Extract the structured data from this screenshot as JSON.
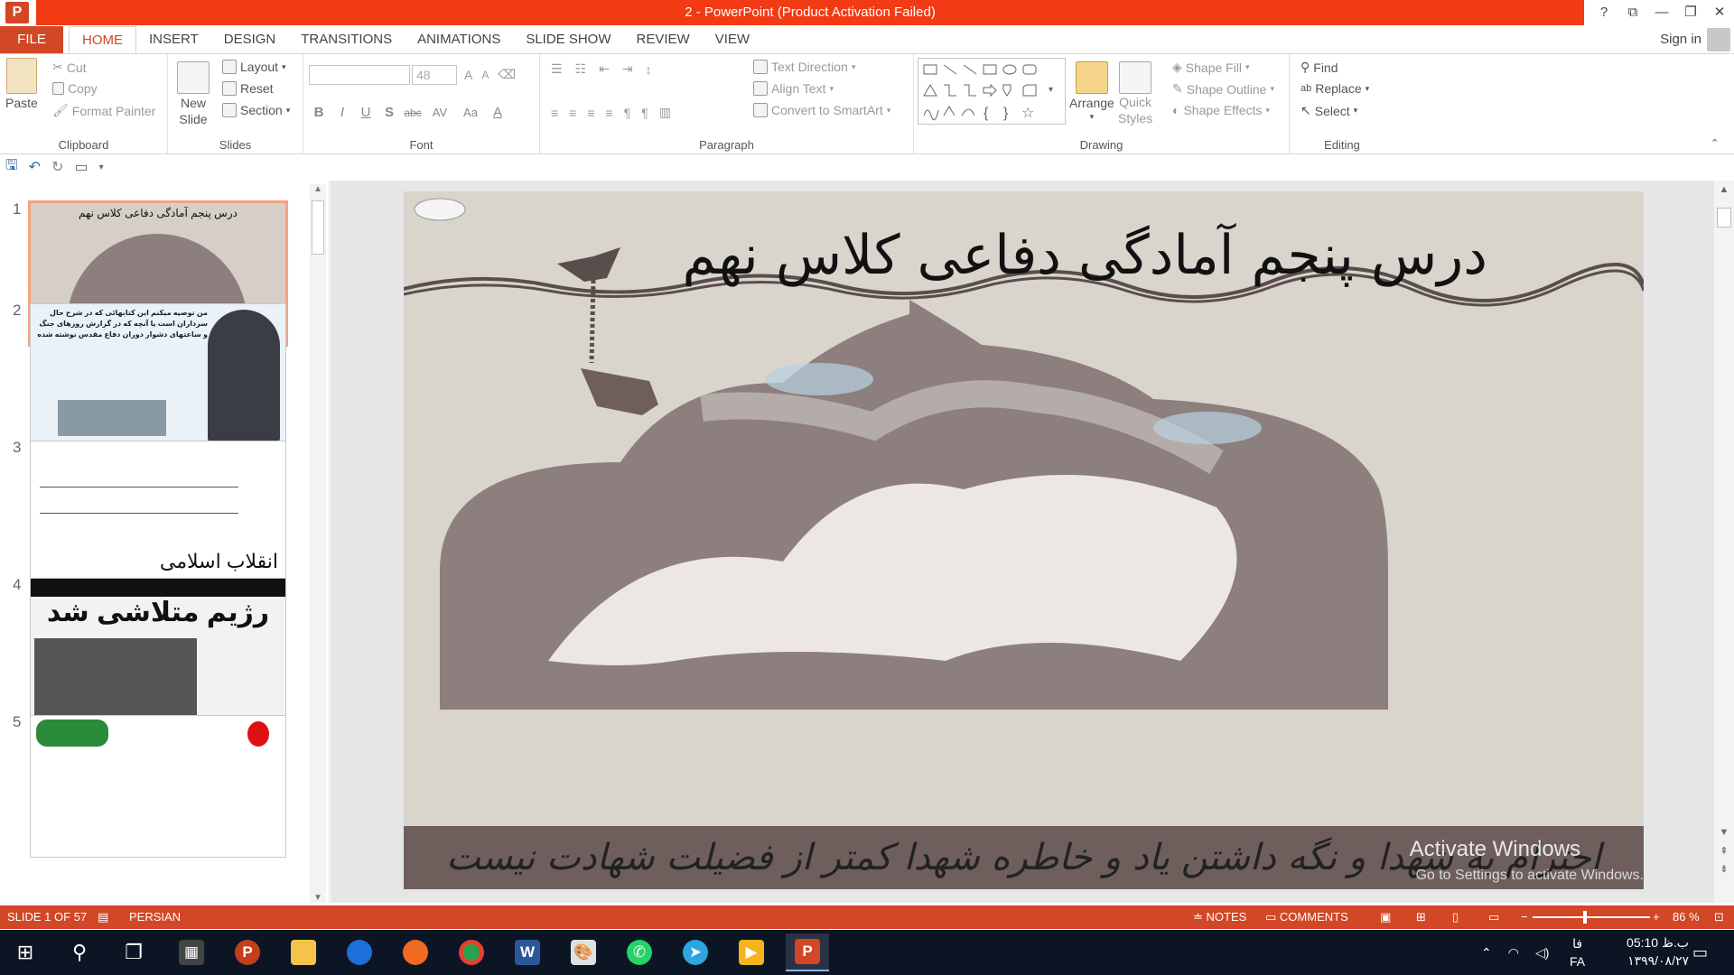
{
  "window": {
    "title": "2 -  PowerPoint (Product Activation Failed)",
    "app_icon": "P",
    "buttons": {
      "help": "?",
      "ribbon_options": "⧉",
      "minimize": "—",
      "restore": "❐",
      "close": "✕"
    }
  },
  "tabs": {
    "file": "FILE",
    "items": [
      "HOME",
      "INSERT",
      "DESIGN",
      "TRANSITIONS",
      "ANIMATIONS",
      "SLIDE SHOW",
      "REVIEW",
      "VIEW"
    ],
    "active": "HOME",
    "sign_in": "Sign in"
  },
  "ribbon": {
    "clipboard": {
      "label": "Clipboard",
      "paste": "Paste",
      "cut": "Cut",
      "copy": "Copy",
      "format_painter": "Format Painter"
    },
    "slides": {
      "label": "Slides",
      "new_slide_1": "New",
      "new_slide_2": "Slide",
      "layout": "Layout",
      "reset": "Reset",
      "section": "Section"
    },
    "font": {
      "label": "Font",
      "font_name": "",
      "font_size": "48",
      "bold": "B",
      "italic": "I",
      "underline": "U",
      "shadow": "S",
      "strike": "abc",
      "spacing": "AV",
      "case": "Aa",
      "color": "A",
      "grow": "A",
      "shrink": "A"
    },
    "paragraph": {
      "label": "Paragraph",
      "text_direction": "Text Direction",
      "align_text": "Align Text",
      "smartart": "Convert to SmartArt"
    },
    "drawing": {
      "label": "Drawing",
      "arrange": "Arrange",
      "quick_styles_1": "Quick",
      "quick_styles_2": "Styles",
      "shape_fill": "Shape Fill",
      "shape_outline": "Shape Outline",
      "shape_effects": "Shape Effects"
    },
    "editing": {
      "label": "Editing",
      "find": "Find",
      "replace": "Replace",
      "select": "Select"
    }
  },
  "thumbnails": [
    {
      "num": "1",
      "text": "درس پنجم آمادگی دفاعی کلاس نهم"
    },
    {
      "num": "2",
      "text": "من توصیه میکنم این کتابهائی که در شرح حال سرداران است یا آنچه که در گزارش روزهای جنگ و ساعتهای دشوار دوران دفاع مقدس نوشته شده"
    },
    {
      "num": "3",
      "text": "انقلاب اسلامی"
    },
    {
      "num": "4",
      "text": "رژیم متلاشی شد"
    },
    {
      "num": "5",
      "text": ""
    }
  ],
  "slide": {
    "title": "درس پنجم آمادگی دفاعی کلاس نهم",
    "caption": "احترام به شهدا و نگه داشتن یاد و خاطره شهدا کمتر از فضیلت شهادت نیست",
    "watermark_1": "Activate Windows",
    "watermark_2": "Go to Settings to activate Windows."
  },
  "status": {
    "slide_info": "SLIDE 1 OF 57",
    "language": "PERSIAN",
    "notes": "NOTES",
    "comments": "COMMENTS",
    "zoom": "86 %",
    "zoom_level": 0.43
  },
  "taskbar": {
    "time": "05:10 ب.ظ",
    "date": "۱۳۹۹/۰۸/۲۷",
    "lang_1": "فا",
    "lang_2": "FA"
  },
  "colors": {
    "accent": "#d24726",
    "titlebar": "#f23a14",
    "taskbar": "#0c1524"
  }
}
